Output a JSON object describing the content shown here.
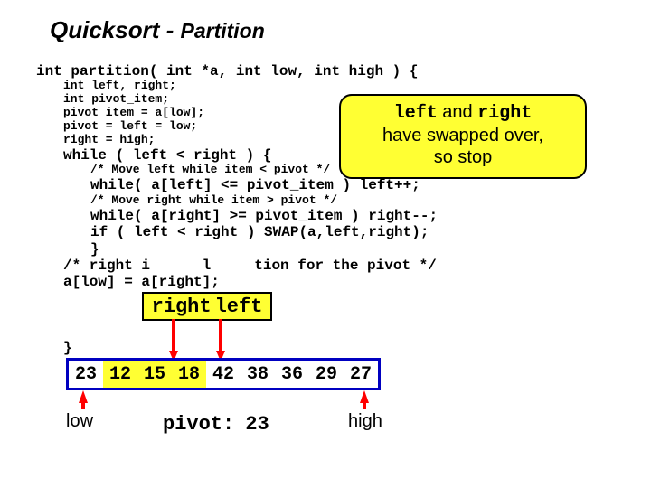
{
  "title": {
    "main": "Quicksort - ",
    "sub": "Partition"
  },
  "callout": {
    "l1a": "left",
    "l1b": " and ",
    "l1c": "right",
    "l2": "have swapped over,",
    "l3": "so stop"
  },
  "code": {
    "sig": "int partition( int *a, int low, int high ) {",
    "d1": "int left, right;",
    "d2": "int pivot_item;",
    "d3": "pivot_item = a[low];",
    "d4": "pivot = left = low;",
    "d5": "right = high;",
    "w1": "while ( left < right ) {",
    "c1": "/* Move left while item < pivot */",
    "w2": "while( a[left] <= pivot_item ) left++;",
    "c2": "/* Move right while item > pivot */",
    "w3": "while( a[right] >= pivot_item ) right--;",
    "if1": "if ( left < right ) SWAP(a,left,right);",
    "cb": "}",
    "c3a": "/* right i",
    "c3b": "l ",
    "c3c": "tion for the pivot */",
    "as1": "a[low] = a[right];",
    "cb2": "}"
  },
  "rl": {
    "right": "right",
    "left": "left"
  },
  "array": {
    "values": [
      "23",
      "12",
      "15",
      "18",
      "42",
      "38",
      "36",
      "29",
      "27"
    ]
  },
  "labels": {
    "low": "low",
    "high": "high",
    "pivot_word": "pivot:",
    "pivot_val": "23"
  }
}
